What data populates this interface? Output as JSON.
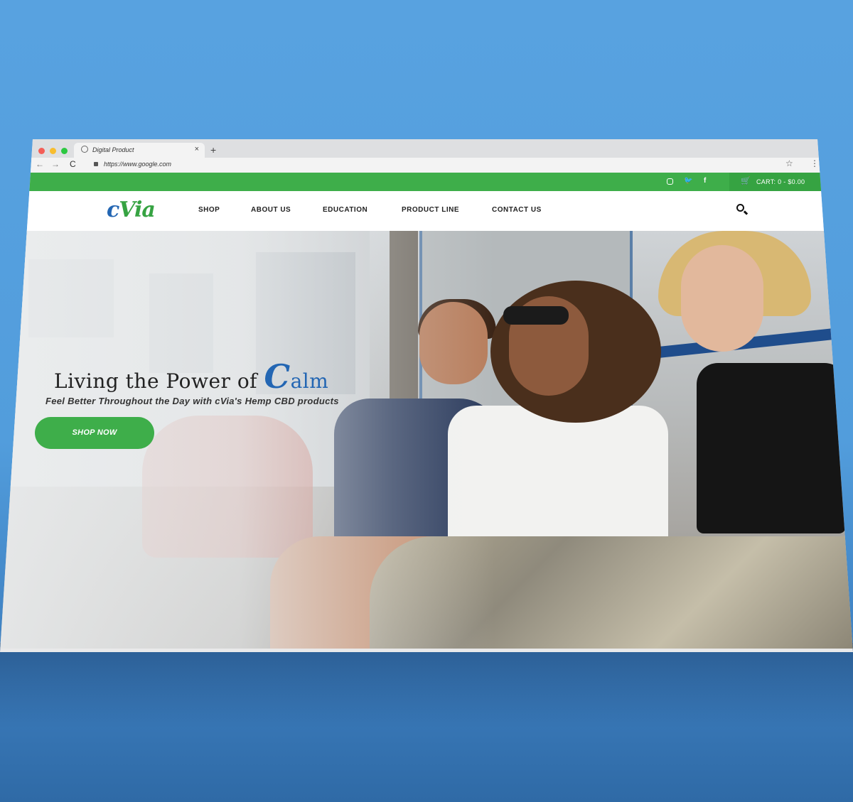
{
  "browser": {
    "tab_title": "Digital Product",
    "tab_close": "×",
    "new_tab": "+",
    "back": "←",
    "forward": "→",
    "reload": "C",
    "url": "https://www.google.com",
    "star": "☆",
    "menu": "⋮"
  },
  "topbar": {
    "social": {
      "twitter": "🐦",
      "facebook": "f"
    },
    "cart_icon": "🛒",
    "cart_label": "CART: 0 - $0.00"
  },
  "header": {
    "logo_c": "c",
    "logo_via": "Via",
    "menu": [
      {
        "label": "SHOP"
      },
      {
        "label": "ABOUT US"
      },
      {
        "label": "EDUCATION"
      },
      {
        "label": "PRODUCT LINE"
      },
      {
        "label": "CONTACT US"
      }
    ]
  },
  "hero": {
    "headline_prefix": "Living the Power of ",
    "headline_c": "C",
    "headline_rest": "alm",
    "subline": "Feel Better Throughout the Day with cVia's Hemp CBD products",
    "cta_label": "SHOP NOW"
  },
  "colors": {
    "brand_green": "#3eae4a",
    "brand_blue": "#2366b3",
    "background": "#529ddc"
  }
}
